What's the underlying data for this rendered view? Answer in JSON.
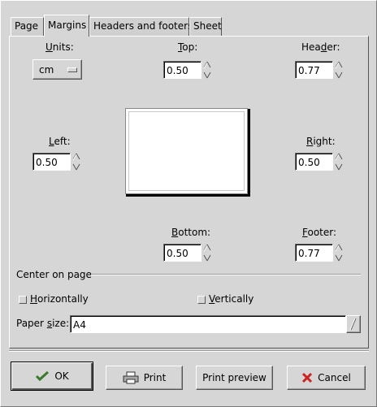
{
  "tabs": [
    {
      "label": "Page"
    },
    {
      "label": "Margins"
    },
    {
      "label": "Headers and footers"
    },
    {
      "label": "Sheet"
    }
  ],
  "units": {
    "label_mnemonic": "U",
    "label_rest": "nits:",
    "value": "cm"
  },
  "top": {
    "label_mnemonic": "T",
    "label_rest": "op:",
    "value": "0.50"
  },
  "header": {
    "label_pre": "Hea",
    "label_mnemonic": "d",
    "label_rest": "er:",
    "value": "0.77"
  },
  "left": {
    "label_mnemonic": "L",
    "label_rest": "eft:",
    "value": "0.50"
  },
  "right": {
    "label_mnemonic": "R",
    "label_rest": "ight:",
    "value": "0.50"
  },
  "bottom": {
    "label_mnemonic": "B",
    "label_rest": "ottom:",
    "value": "0.50"
  },
  "footer": {
    "label_mnemonic": "F",
    "label_rest": "ooter:",
    "value": "0.77"
  },
  "center": {
    "title": "Center on page",
    "horizontally_mnemonic": "H",
    "horizontally_rest": "orizontally",
    "vertically_mnemonic": "V",
    "vertically_rest": "ertically"
  },
  "paper_size": {
    "label_pre": "Paper ",
    "label_mnemonic": "s",
    "label_rest": "ize:",
    "value": "A4"
  },
  "buttons": {
    "ok": "OK",
    "print": "Print",
    "print_preview": "Print preview",
    "cancel": "Cancel"
  },
  "icons": {
    "ok": "check-icon",
    "print": "printer-icon",
    "cancel": "x-icon"
  },
  "colors": {
    "window": "#d6d6d6",
    "cancel_x": "#cc2222",
    "ok_check": "#3a7a2a"
  }
}
